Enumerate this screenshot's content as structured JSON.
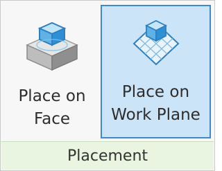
{
  "ribbon_panel": {
    "buttons": [
      {
        "id": "place-on-face",
        "line1": "Place on",
        "line2": "Face",
        "icon": "face-cube-icon",
        "selected": false
      },
      {
        "id": "place-on-work-plane",
        "line1": "Place on",
        "line2": "Work Plane",
        "icon": "work-plane-icon",
        "selected": true
      }
    ],
    "footer_label": "Placement"
  },
  "colors": {
    "selected_bg": "#cce4f7",
    "selected_border": "#3c89cf",
    "footer_bg": "#e9f4e1"
  }
}
